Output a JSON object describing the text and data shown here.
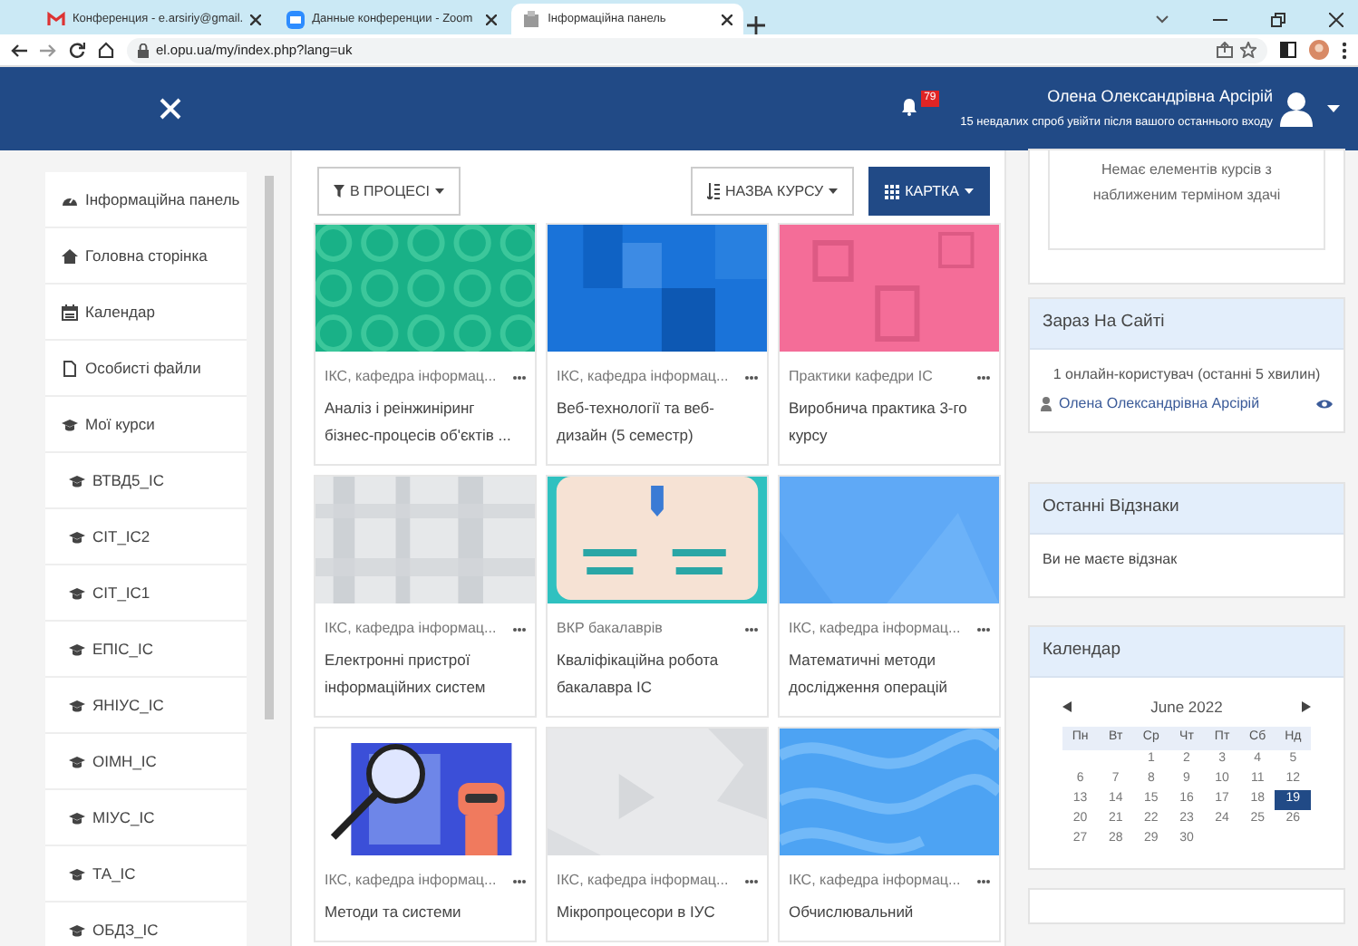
{
  "browser": {
    "tabs": [
      {
        "title": "Конференция - e.arsiriy@gmail.",
        "kind": "mail",
        "selected": false
      },
      {
        "title": "Данные конференции - Zoom",
        "kind": "zoom",
        "selected": false
      },
      {
        "title": "Інформаційна панель",
        "kind": "site",
        "selected": true
      }
    ],
    "address": "el.opu.ua/my/index.php?lang=uk"
  },
  "navbar": {
    "notifications": "79",
    "user_name": "Олена Олександрівна Арсірій",
    "login_notice": "15 невдалих спроб увійти після вашого останнього входу"
  },
  "sidebar": {
    "items": [
      {
        "label": "Інформаційна панель",
        "kind": "dashboard"
      },
      {
        "label": "Головна сторінка",
        "kind": "home"
      },
      {
        "label": "Календар",
        "kind": "calendar"
      },
      {
        "label": "Особисті файли",
        "kind": "file"
      },
      {
        "label": "Мої курси",
        "kind": "courses",
        "children": [
          {
            "label": "ВТВД5_ІС",
            "kind": "courses"
          },
          {
            "label": "СІТ_ІС2",
            "kind": "courses"
          },
          {
            "label": "СІТ_ІС1",
            "kind": "courses"
          },
          {
            "label": "ЕПІС_ІС",
            "kind": "courses"
          },
          {
            "label": "ЯНІУС_ІС",
            "kind": "courses"
          },
          {
            "label": "ОІМН_ІС",
            "kind": "courses"
          },
          {
            "label": "МІУС_ІС",
            "kind": "courses"
          },
          {
            "label": "ТА_ІС",
            "kind": "courses"
          },
          {
            "label": "ОБДЗ_ІС",
            "kind": "courses"
          }
        ]
      }
    ]
  },
  "toolbar": {
    "filter": "В ПРОЦЕСІ",
    "sort": "НАЗВА КУРСУ",
    "view": "КАРТКА"
  },
  "courses": [
    {
      "category": "ІКС, кафедра інформац...",
      "title": "Аналіз і реінжиніринг бізнес-процесів об'єктів ..."
    },
    {
      "category": "ІКС, кафедра інформац...",
      "title": "Веб-технології та веб-дизайн (5 семестр)"
    },
    {
      "category": "Практики кафедри ІС",
      "title": "Виробнича практика 3-го курсу"
    },
    {
      "category": "ІКС, кафедра інформац...",
      "title": "Електронні пристрої інформаційних систем"
    },
    {
      "category": "ВКР бакалаврів",
      "title": "Кваліфікаційна робота бакалавра ІС"
    },
    {
      "category": "ІКС, кафедра інформац...",
      "title": "Математичні методи дослідження операцій"
    },
    {
      "category": "ІКС, кафедра інформац...",
      "title": "Методи та системи"
    },
    {
      "category": "ІКС, кафедра інформац...",
      "title": "Мікропроцесори в ІУС"
    },
    {
      "category": "ІКС, кафедра інформац...",
      "title": "Обчислювальний"
    }
  ],
  "blocks": {
    "timeline_empty": "Немає елементів курсів з наближеним терміном здачі",
    "online": {
      "title": "Зараз На Сайті",
      "summary": "1 онлайн-користувач (останні 5 хвилин)",
      "users": [
        "Олена Олександрівна Арсірій"
      ]
    },
    "badges": {
      "title": "Останні Відзнаки",
      "text": "Ви не маєте відзнак"
    },
    "calendar": {
      "title": "Календар",
      "month": "June 2022",
      "weekdays": [
        "Пн",
        "Вт",
        "Ср",
        "Чт",
        "Пт",
        "Сб",
        "Нд"
      ],
      "weeks": [
        {
          "kind": "lead",
          "days": [
            {
              "day": "1",
              "selected": false
            },
            {
              "day": "2",
              "selected": false
            },
            {
              "day": "3",
              "selected": false
            },
            {
              "day": "4",
              "selected": false
            },
            {
              "day": "5",
              "selected": false
            }
          ]
        },
        {
          "kind": "week",
          "days": [
            {
              "day": "6",
              "selected": false
            },
            {
              "day": "7",
              "selected": false
            },
            {
              "day": "8",
              "selected": false
            },
            {
              "day": "9",
              "selected": false
            },
            {
              "day": "10",
              "selected": false
            },
            {
              "day": "11",
              "selected": false
            },
            {
              "day": "12",
              "selected": false
            }
          ]
        },
        {
          "kind": "week",
          "days": [
            {
              "day": "13",
              "selected": false
            },
            {
              "day": "14",
              "selected": false
            },
            {
              "day": "15",
              "selected": false
            },
            {
              "day": "16",
              "selected": false
            },
            {
              "day": "17",
              "selected": false
            },
            {
              "day": "18",
              "selected": false
            },
            {
              "day": "19",
              "selected": true
            }
          ]
        },
        {
          "kind": "week",
          "days": [
            {
              "day": "20",
              "selected": false
            },
            {
              "day": "21",
              "selected": false
            },
            {
              "day": "22",
              "selected": false
            },
            {
              "day": "23",
              "selected": false
            },
            {
              "day": "24",
              "selected": false
            },
            {
              "day": "25",
              "selected": false
            },
            {
              "day": "26",
              "selected": false
            }
          ]
        },
        {
          "kind": "week",
          "days": [
            {
              "day": "27",
              "selected": false
            },
            {
              "day": "28",
              "selected": false
            },
            {
              "day": "29",
              "selected": false
            },
            {
              "day": "30",
              "selected": false
            }
          ]
        }
      ]
    }
  }
}
